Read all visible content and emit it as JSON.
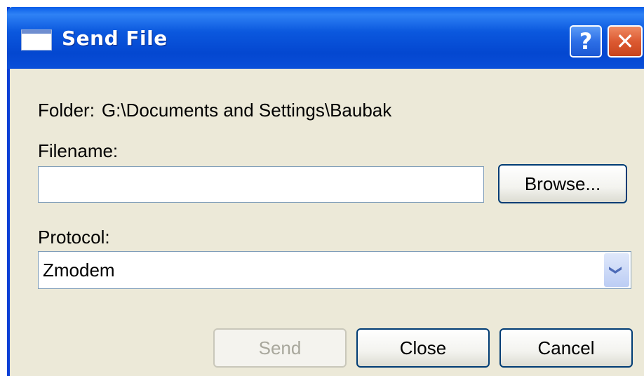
{
  "window": {
    "title": "Send File",
    "help_glyph": "?",
    "close_glyph": "✕",
    "title_icon": "window-icon"
  },
  "folder": {
    "label": "Folder:",
    "value": "G:\\Documents and Settings\\Baubak"
  },
  "filename": {
    "label": "Filename:",
    "value": "",
    "browse_label": "Browse..."
  },
  "protocol": {
    "label": "Protocol:",
    "selected": "Zmodem",
    "arrow_glyph": "❯"
  },
  "buttons": {
    "send": "Send",
    "close": "Close",
    "cancel": "Cancel"
  },
  "colors": {
    "titlebar": "#0b58de",
    "dialog_bg": "#ece9d8",
    "close_button": "#dc5a32"
  }
}
